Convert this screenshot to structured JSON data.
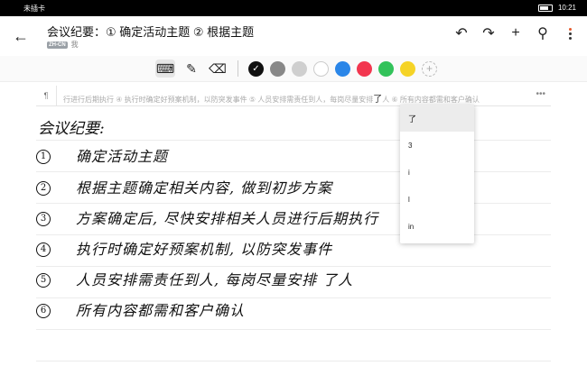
{
  "status": {
    "carrier": "未插卡",
    "time": "10:21"
  },
  "appbar": {
    "title": "会议纪要：① 确定活动主题 ② 根据主题",
    "lang_chip": "ZH-CN",
    "lang_text": "我"
  },
  "icons": {
    "back": "back-arrow-icon",
    "undo": "undo-icon",
    "redo": "redo-icon",
    "add": "plus-icon",
    "search": "search-icon",
    "more": "more-vertical-icon"
  },
  "toolbar": {
    "colors": [
      "#111111",
      "#888888",
      "#cfcfcf",
      "#ffffff",
      "#2a86e8",
      "#f2364f",
      "#32c25a",
      "#f5d326"
    ]
  },
  "candidates": {
    "text": "行进行后期执行 ④ 执行时确定好预案机制，以防突发事件 ⑤ 人员安排需责任到人，每岗尽量安排",
    "highlight": "了",
    "tail": "人 ⑥ 所有内容都需和客户确认",
    "para_icon": "¶",
    "more": "•••"
  },
  "note": {
    "title": "会议纪要:",
    "lines": [
      {
        "n": "1",
        "text": "确定活动主题"
      },
      {
        "n": "2",
        "text": "根据主题确定相关内容, 做到初步方案"
      },
      {
        "n": "3",
        "text": "方案确定后, 尽快安排相关人员进行后期执行"
      },
      {
        "n": "4",
        "text": "执行时确定好预案机制, 以防突发事件"
      },
      {
        "n": "5",
        "text": "人员安排需责任到人, 每岗尽量安排 了人"
      },
      {
        "n": "6",
        "text": "所有内容都需和客户确认"
      }
    ]
  },
  "popup": {
    "items": [
      "了",
      "3",
      "i",
      "l",
      "in"
    ]
  }
}
